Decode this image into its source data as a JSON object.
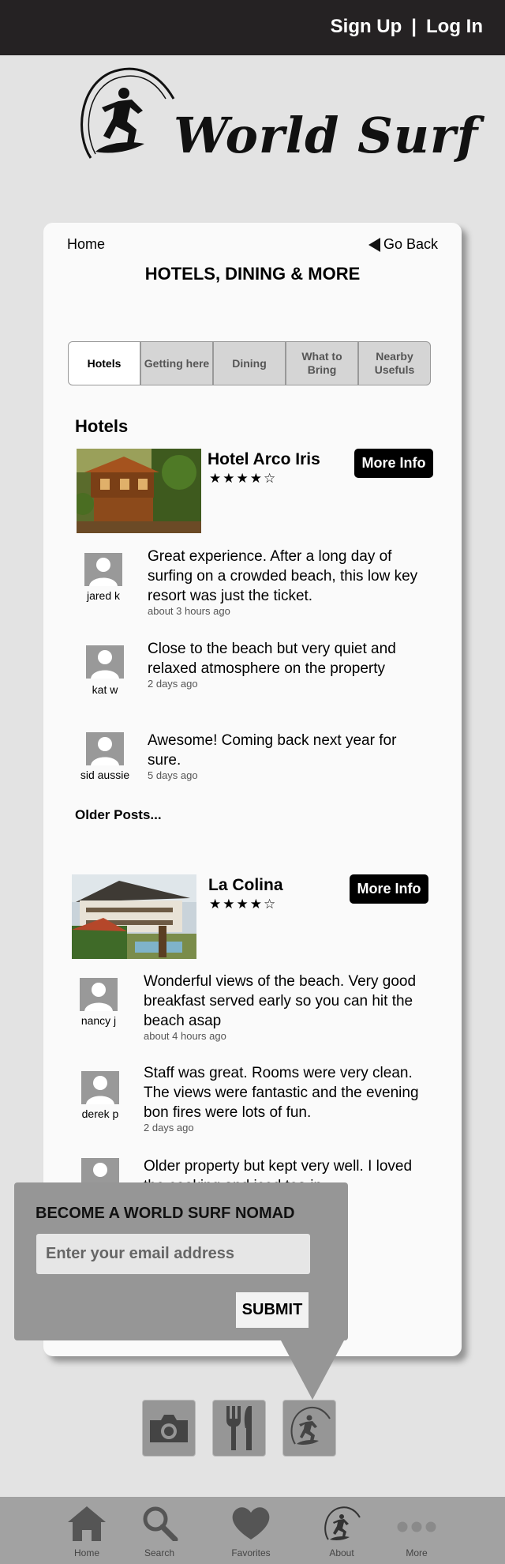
{
  "header": {
    "sign_up": "Sign Up",
    "separator": "|",
    "log_in": "Log In"
  },
  "logo": {
    "text": "World Surf"
  },
  "nav": {
    "home": "Home",
    "back": "Go Back"
  },
  "page_title": "HOTELS, DINING & MORE",
  "tabs": [
    {
      "label": "Hotels",
      "active": true
    },
    {
      "label": "Getting here"
    },
    {
      "label": "Dining"
    },
    {
      "label": "What to Bring"
    },
    {
      "label": "Nearby Usefuls"
    }
  ],
  "section_title": "Hotels",
  "hotels": [
    {
      "name": "Hotel Arco Iris",
      "stars": "★★★★☆",
      "more_label": "More Info",
      "reviews": [
        {
          "user": "jared k",
          "text": "Great experience. After a long day of surfing on a crowded beach, this low key resort was just the ticket.",
          "time": "about 3 hours ago"
        },
        {
          "user": "kat w",
          "text": "Close to the beach but very quiet and relaxed atmosphere on the property",
          "time": "2 days ago"
        },
        {
          "user": "sid aussie",
          "text": "Awesome! Coming back next year for sure.",
          "time": "5 days ago"
        }
      ]
    },
    {
      "name": "La Colina",
      "stars": "★★★★☆",
      "more_label": "More Info",
      "reviews": [
        {
          "user": "nancy j",
          "text": "Wonderful views of the beach. Very good breakfast served early so you can hit the beach asap",
          "time": "about 4 hours ago"
        },
        {
          "user": "derek p",
          "text": "Staff was great.  Rooms were very clean. The views were fantastic and the evening bon fires were lots of fun.",
          "time": "2 days ago"
        },
        {
          "user": "",
          "text": "Older property but kept very well. I loved the cooking and iced tea in",
          "time": ""
        }
      ]
    }
  ],
  "older_posts": "Older Posts...",
  "newsletter": {
    "title": "BECOME A WORLD SURF NOMAD",
    "placeholder": "Enter your email address",
    "submit": "SUBMIT"
  },
  "quick_icons": [
    "camera-icon",
    "dining-icon",
    "surfer-icon"
  ],
  "bottom_nav": [
    {
      "label": "Home",
      "icon": "home-icon"
    },
    {
      "label": "Search",
      "icon": "search-icon"
    },
    {
      "label": "Favorites",
      "icon": "heart-icon"
    },
    {
      "label": "About",
      "icon": "surfer-icon"
    },
    {
      "label": "More",
      "icon": "more-icon"
    }
  ]
}
